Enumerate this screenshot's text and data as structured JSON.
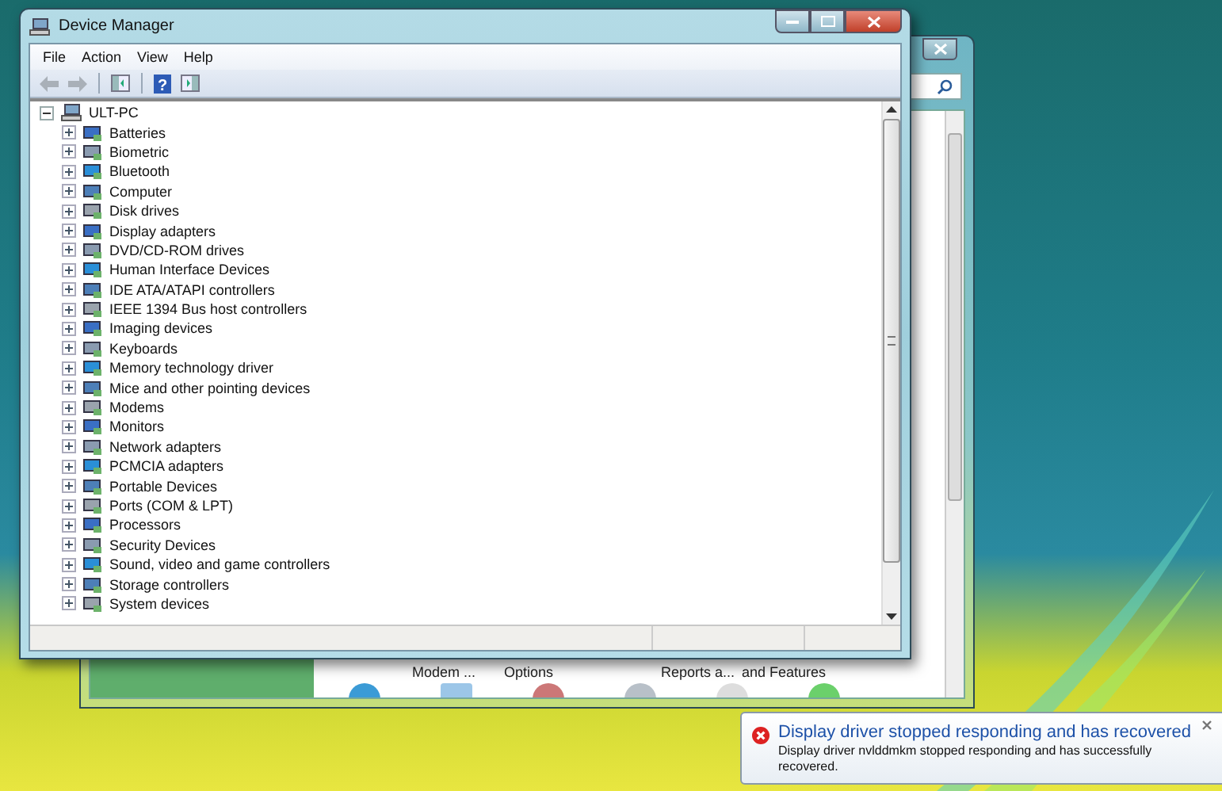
{
  "back_window": {
    "labels": [
      "Modem ...",
      "Options",
      "Reports a...",
      "and Features"
    ]
  },
  "window": {
    "title": "Device Manager",
    "menu": [
      "File",
      "Action",
      "View",
      "Help"
    ],
    "toolbar": [
      {
        "kind": "back",
        "disabled": true
      },
      {
        "kind": "forward",
        "disabled": true
      },
      {
        "kind": "tree",
        "disabled": false
      },
      {
        "kind": "help",
        "disabled": false,
        "label": "?"
      },
      {
        "kind": "properties",
        "disabled": false
      }
    ],
    "tree": {
      "label": "ULT-PC",
      "expanded": true,
      "children": [
        {
          "label": "Batteries",
          "expanded": false
        },
        {
          "label": "Biometric",
          "expanded": false
        },
        {
          "label": "Bluetooth",
          "expanded": false
        },
        {
          "label": "Computer",
          "expanded": false
        },
        {
          "label": "Disk drives",
          "expanded": false
        },
        {
          "label": "Display adapters",
          "expanded": false
        },
        {
          "label": "DVD/CD-ROM drives",
          "expanded": false
        },
        {
          "label": "Human Interface Devices",
          "expanded": false
        },
        {
          "label": "IDE ATA/ATAPI controllers",
          "expanded": false
        },
        {
          "label": "IEEE 1394 Bus host controllers",
          "expanded": false
        },
        {
          "label": "Imaging devices",
          "expanded": false
        },
        {
          "label": "Keyboards",
          "expanded": false
        },
        {
          "label": "Memory technology driver",
          "expanded": false
        },
        {
          "label": "Mice and other pointing devices",
          "expanded": false
        },
        {
          "label": "Modems",
          "expanded": false
        },
        {
          "label": "Monitors",
          "expanded": false
        },
        {
          "label": "Network adapters",
          "expanded": false
        },
        {
          "label": "PCMCIA adapters",
          "expanded": false
        },
        {
          "label": "Portable Devices",
          "expanded": false
        },
        {
          "label": "Ports (COM & LPT)",
          "expanded": false
        },
        {
          "label": "Processors",
          "expanded": false
        },
        {
          "label": "Security Devices",
          "expanded": false
        },
        {
          "label": "Sound, video and game controllers",
          "expanded": false
        },
        {
          "label": "Storage controllers",
          "expanded": false
        },
        {
          "label": "System devices",
          "expanded": false
        }
      ]
    }
  },
  "notification": {
    "title": "Display driver stopped responding and has recovered",
    "message": "Display driver nvlddmkm stopped responding and has successfully recovered."
  }
}
